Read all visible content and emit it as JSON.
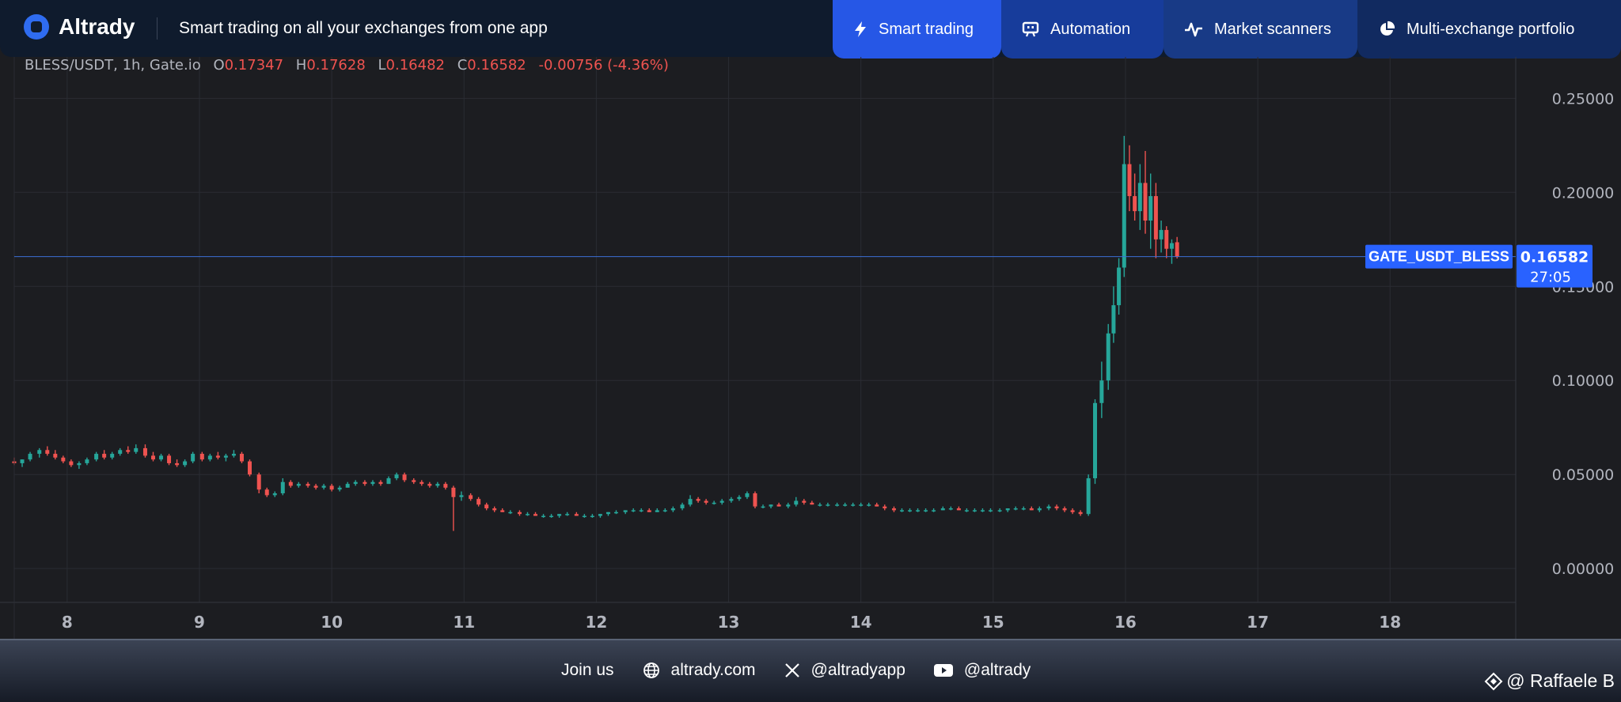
{
  "header": {
    "brand": "Altrady",
    "tagline": "Smart trading on all your exchanges from one app",
    "tabs": [
      {
        "label": "Smart trading",
        "icon": "lightning-icon"
      },
      {
        "label": "Automation",
        "icon": "bot-icon"
      },
      {
        "label": "Market scanners",
        "icon": "pulse-icon"
      },
      {
        "label": "Multi-exchange portfolio",
        "icon": "pie-chart-icon"
      }
    ]
  },
  "legend": {
    "symbol": "BLESS/USDT, 1h, Gate.io",
    "open_label": "O",
    "open": "0.17347",
    "high_label": "H",
    "high": "0.17628",
    "low_label": "L",
    "low": "0.16482",
    "close_label": "C",
    "close": "0.16582",
    "change": "-0.00756 (-4.36%)"
  },
  "price_tag": {
    "name": "GATE_USDT_BLESS",
    "price": "0.16582",
    "countdown": "27:05"
  },
  "footer": {
    "join": "Join us",
    "website": "altrady.com",
    "twitter": "@altradyapp",
    "youtube": "@altrady"
  },
  "watermark": "@ Raffaele B",
  "colors": {
    "up": "#26a69a",
    "down": "#ef5350",
    "accent": "#2962ff",
    "background": "#1c1d21"
  },
  "chart_data": {
    "type": "candlestick",
    "x_ticks": [
      8,
      9,
      10,
      11,
      12,
      13,
      14,
      15,
      16,
      17,
      18
    ],
    "y_ticks": [
      0,
      0.05,
      0.1,
      0.15,
      0.2,
      0.25
    ],
    "y_tick_labels": [
      "0.00000",
      "0.05000",
      "0.10000",
      "0.15000",
      "0.20000",
      "0.25000"
    ],
    "xlim": [
      7.6,
      18.95
    ],
    "ylim": [
      -0.018,
      0.272
    ],
    "last_price": 0.16582,
    "candles": [
      {
        "t": 7.6,
        "o": 0.057,
        "h": 0.059,
        "l": 0.055,
        "c": 0.056
      },
      {
        "t": 7.66,
        "o": 0.056,
        "h": 0.058,
        "l": 0.054,
        "c": 0.058
      },
      {
        "t": 7.72,
        "o": 0.058,
        "h": 0.062,
        "l": 0.057,
        "c": 0.061
      },
      {
        "t": 7.79,
        "o": 0.061,
        "h": 0.064,
        "l": 0.059,
        "c": 0.063
      },
      {
        "t": 7.85,
        "o": 0.063,
        "h": 0.065,
        "l": 0.06,
        "c": 0.061
      },
      {
        "t": 7.91,
        "o": 0.061,
        "h": 0.063,
        "l": 0.058,
        "c": 0.059
      },
      {
        "t": 7.97,
        "o": 0.059,
        "h": 0.06,
        "l": 0.056,
        "c": 0.057
      },
      {
        "t": 8.03,
        "o": 0.057,
        "h": 0.058,
        "l": 0.054,
        "c": 0.055
      },
      {
        "t": 8.09,
        "o": 0.055,
        "h": 0.057,
        "l": 0.053,
        "c": 0.056
      },
      {
        "t": 8.15,
        "o": 0.056,
        "h": 0.059,
        "l": 0.055,
        "c": 0.058
      },
      {
        "t": 8.22,
        "o": 0.058,
        "h": 0.062,
        "l": 0.057,
        "c": 0.061
      },
      {
        "t": 8.28,
        "o": 0.061,
        "h": 0.063,
        "l": 0.058,
        "c": 0.059
      },
      {
        "t": 8.34,
        "o": 0.059,
        "h": 0.062,
        "l": 0.058,
        "c": 0.061
      },
      {
        "t": 8.4,
        "o": 0.061,
        "h": 0.064,
        "l": 0.06,
        "c": 0.063
      },
      {
        "t": 8.46,
        "o": 0.063,
        "h": 0.065,
        "l": 0.061,
        "c": 0.062
      },
      {
        "t": 8.52,
        "o": 0.062,
        "h": 0.066,
        "l": 0.061,
        "c": 0.064
      },
      {
        "t": 8.59,
        "o": 0.064,
        "h": 0.066,
        "l": 0.059,
        "c": 0.06
      },
      {
        "t": 8.65,
        "o": 0.06,
        "h": 0.062,
        "l": 0.057,
        "c": 0.058
      },
      {
        "t": 8.71,
        "o": 0.058,
        "h": 0.061,
        "l": 0.057,
        "c": 0.06
      },
      {
        "t": 8.77,
        "o": 0.06,
        "h": 0.061,
        "l": 0.055,
        "c": 0.056
      },
      {
        "t": 8.83,
        "o": 0.056,
        "h": 0.058,
        "l": 0.054,
        "c": 0.055
      },
      {
        "t": 8.89,
        "o": 0.055,
        "h": 0.058,
        "l": 0.054,
        "c": 0.057
      },
      {
        "t": 8.95,
        "o": 0.057,
        "h": 0.062,
        "l": 0.056,
        "c": 0.061
      },
      {
        "t": 9.02,
        "o": 0.061,
        "h": 0.062,
        "l": 0.057,
        "c": 0.058
      },
      {
        "t": 9.08,
        "o": 0.058,
        "h": 0.061,
        "l": 0.057,
        "c": 0.06
      },
      {
        "t": 9.14,
        "o": 0.06,
        "h": 0.062,
        "l": 0.058,
        "c": 0.059
      },
      {
        "t": 9.2,
        "o": 0.059,
        "h": 0.061,
        "l": 0.057,
        "c": 0.06
      },
      {
        "t": 9.26,
        "o": 0.06,
        "h": 0.063,
        "l": 0.059,
        "c": 0.061
      },
      {
        "t": 9.32,
        "o": 0.061,
        "h": 0.062,
        "l": 0.056,
        "c": 0.057
      },
      {
        "t": 9.38,
        "o": 0.057,
        "h": 0.058,
        "l": 0.049,
        "c": 0.05
      },
      {
        "t": 9.45,
        "o": 0.05,
        "h": 0.051,
        "l": 0.04,
        "c": 0.042
      },
      {
        "t": 9.51,
        "o": 0.042,
        "h": 0.043,
        "l": 0.038,
        "c": 0.039
      },
      {
        "t": 9.57,
        "o": 0.039,
        "h": 0.041,
        "l": 0.038,
        "c": 0.04
      },
      {
        "t": 9.63,
        "o": 0.04,
        "h": 0.048,
        "l": 0.039,
        "c": 0.046
      },
      {
        "t": 9.69,
        "o": 0.046,
        "h": 0.047,
        "l": 0.043,
        "c": 0.044
      },
      {
        "t": 9.75,
        "o": 0.044,
        "h": 0.046,
        "l": 0.043,
        "c": 0.045
      },
      {
        "t": 9.82,
        "o": 0.045,
        "h": 0.046,
        "l": 0.043,
        "c": 0.044
      },
      {
        "t": 9.88,
        "o": 0.044,
        "h": 0.045,
        "l": 0.042,
        "c": 0.043
      },
      {
        "t": 9.94,
        "o": 0.043,
        "h": 0.045,
        "l": 0.042,
        "c": 0.044
      },
      {
        "t": 10.0,
        "o": 0.044,
        "h": 0.045,
        "l": 0.041,
        "c": 0.042
      },
      {
        "t": 10.06,
        "o": 0.042,
        "h": 0.044,
        "l": 0.041,
        "c": 0.043
      },
      {
        "t": 10.12,
        "o": 0.043,
        "h": 0.046,
        "l": 0.043,
        "c": 0.045
      },
      {
        "t": 10.18,
        "o": 0.045,
        "h": 0.047,
        "l": 0.044,
        "c": 0.046
      },
      {
        "t": 10.25,
        "o": 0.046,
        "h": 0.047,
        "l": 0.044,
        "c": 0.045
      },
      {
        "t": 10.31,
        "o": 0.045,
        "h": 0.047,
        "l": 0.044,
        "c": 0.046
      },
      {
        "t": 10.37,
        "o": 0.046,
        "h": 0.047,
        "l": 0.044,
        "c": 0.045
      },
      {
        "t": 10.43,
        "o": 0.045,
        "h": 0.049,
        "l": 0.045,
        "c": 0.048
      },
      {
        "t": 10.49,
        "o": 0.048,
        "h": 0.051,
        "l": 0.047,
        "c": 0.05
      },
      {
        "t": 10.55,
        "o": 0.05,
        "h": 0.051,
        "l": 0.046,
        "c": 0.047
      },
      {
        "t": 10.62,
        "o": 0.047,
        "h": 0.048,
        "l": 0.045,
        "c": 0.046
      },
      {
        "t": 10.68,
        "o": 0.046,
        "h": 0.047,
        "l": 0.044,
        "c": 0.045
      },
      {
        "t": 10.74,
        "o": 0.045,
        "h": 0.046,
        "l": 0.043,
        "c": 0.044
      },
      {
        "t": 10.8,
        "o": 0.044,
        "h": 0.046,
        "l": 0.043,
        "c": 0.045
      },
      {
        "t": 10.86,
        "o": 0.045,
        "h": 0.046,
        "l": 0.042,
        "c": 0.043
      },
      {
        "t": 10.92,
        "o": 0.043,
        "h": 0.044,
        "l": 0.02,
        "c": 0.038
      },
      {
        "t": 10.98,
        "o": 0.038,
        "h": 0.041,
        "l": 0.036,
        "c": 0.039
      },
      {
        "t": 11.05,
        "o": 0.039,
        "h": 0.04,
        "l": 0.036,
        "c": 0.037
      },
      {
        "t": 11.11,
        "o": 0.037,
        "h": 0.038,
        "l": 0.033,
        "c": 0.034
      },
      {
        "t": 11.17,
        "o": 0.034,
        "h": 0.035,
        "l": 0.031,
        "c": 0.032
      },
      {
        "t": 11.23,
        "o": 0.032,
        "h": 0.033,
        "l": 0.03,
        "c": 0.031
      },
      {
        "t": 11.29,
        "o": 0.031,
        "h": 0.032,
        "l": 0.03,
        "c": 0.03
      },
      {
        "t": 11.35,
        "o": 0.03,
        "h": 0.031,
        "l": 0.029,
        "c": 0.03
      },
      {
        "t": 11.42,
        "o": 0.03,
        "h": 0.031,
        "l": 0.028,
        "c": 0.029
      },
      {
        "t": 11.48,
        "o": 0.029,
        "h": 0.03,
        "l": 0.028,
        "c": 0.029
      },
      {
        "t": 11.54,
        "o": 0.029,
        "h": 0.03,
        "l": 0.028,
        "c": 0.028
      },
      {
        "t": 11.6,
        "o": 0.028,
        "h": 0.029,
        "l": 0.027,
        "c": 0.028
      },
      {
        "t": 11.66,
        "o": 0.028,
        "h": 0.029,
        "l": 0.027,
        "c": 0.028
      },
      {
        "t": 11.72,
        "o": 0.028,
        "h": 0.029,
        "l": 0.027,
        "c": 0.029
      },
      {
        "t": 11.78,
        "o": 0.029,
        "h": 0.03,
        "l": 0.028,
        "c": 0.029
      },
      {
        "t": 11.85,
        "o": 0.029,
        "h": 0.03,
        "l": 0.028,
        "c": 0.028
      },
      {
        "t": 11.91,
        "o": 0.028,
        "h": 0.029,
        "l": 0.027,
        "c": 0.028
      },
      {
        "t": 11.97,
        "o": 0.028,
        "h": 0.029,
        "l": 0.027,
        "c": 0.028
      },
      {
        "t": 12.03,
        "o": 0.028,
        "h": 0.029,
        "l": 0.027,
        "c": 0.029
      },
      {
        "t": 12.09,
        "o": 0.029,
        "h": 0.03,
        "l": 0.028,
        "c": 0.03
      },
      {
        "t": 12.15,
        "o": 0.03,
        "h": 0.031,
        "l": 0.029,
        "c": 0.03
      },
      {
        "t": 12.22,
        "o": 0.03,
        "h": 0.031,
        "l": 0.029,
        "c": 0.031
      },
      {
        "t": 12.28,
        "o": 0.031,
        "h": 0.032,
        "l": 0.03,
        "c": 0.031
      },
      {
        "t": 12.34,
        "o": 0.031,
        "h": 0.032,
        "l": 0.03,
        "c": 0.031
      },
      {
        "t": 12.4,
        "o": 0.031,
        "h": 0.032,
        "l": 0.03,
        "c": 0.03
      },
      {
        "t": 12.46,
        "o": 0.03,
        "h": 0.032,
        "l": 0.03,
        "c": 0.031
      },
      {
        "t": 12.52,
        "o": 0.031,
        "h": 0.032,
        "l": 0.03,
        "c": 0.031
      },
      {
        "t": 12.58,
        "o": 0.031,
        "h": 0.033,
        "l": 0.03,
        "c": 0.032
      },
      {
        "t": 12.65,
        "o": 0.032,
        "h": 0.035,
        "l": 0.031,
        "c": 0.034
      },
      {
        "t": 12.71,
        "o": 0.034,
        "h": 0.039,
        "l": 0.033,
        "c": 0.037
      },
      {
        "t": 12.77,
        "o": 0.037,
        "h": 0.038,
        "l": 0.035,
        "c": 0.036
      },
      {
        "t": 12.83,
        "o": 0.036,
        "h": 0.037,
        "l": 0.034,
        "c": 0.035
      },
      {
        "t": 12.89,
        "o": 0.035,
        "h": 0.036,
        "l": 0.034,
        "c": 0.035
      },
      {
        "t": 12.95,
        "o": 0.035,
        "h": 0.037,
        "l": 0.034,
        "c": 0.036
      },
      {
        "t": 13.02,
        "o": 0.036,
        "h": 0.038,
        "l": 0.035,
        "c": 0.037
      },
      {
        "t": 13.08,
        "o": 0.037,
        "h": 0.039,
        "l": 0.036,
        "c": 0.038
      },
      {
        "t": 13.14,
        "o": 0.038,
        "h": 0.041,
        "l": 0.037,
        "c": 0.04
      },
      {
        "t": 13.2,
        "o": 0.04,
        "h": 0.041,
        "l": 0.032,
        "c": 0.033
      },
      {
        "t": 13.26,
        "o": 0.033,
        "h": 0.034,
        "l": 0.032,
        "c": 0.033
      },
      {
        "t": 13.32,
        "o": 0.033,
        "h": 0.034,
        "l": 0.032,
        "c": 0.034
      },
      {
        "t": 13.38,
        "o": 0.034,
        "h": 0.035,
        "l": 0.033,
        "c": 0.033
      },
      {
        "t": 13.45,
        "o": 0.033,
        "h": 0.035,
        "l": 0.032,
        "c": 0.034
      },
      {
        "t": 13.51,
        "o": 0.034,
        "h": 0.038,
        "l": 0.033,
        "c": 0.036
      },
      {
        "t": 13.57,
        "o": 0.036,
        "h": 0.037,
        "l": 0.034,
        "c": 0.035
      },
      {
        "t": 13.63,
        "o": 0.035,
        "h": 0.036,
        "l": 0.034,
        "c": 0.034
      },
      {
        "t": 13.69,
        "o": 0.034,
        "h": 0.035,
        "l": 0.033,
        "c": 0.034
      },
      {
        "t": 13.75,
        "o": 0.034,
        "h": 0.035,
        "l": 0.033,
        "c": 0.034
      },
      {
        "t": 13.82,
        "o": 0.034,
        "h": 0.035,
        "l": 0.033,
        "c": 0.034
      },
      {
        "t": 13.88,
        "o": 0.034,
        "h": 0.035,
        "l": 0.033,
        "c": 0.034
      },
      {
        "t": 13.94,
        "o": 0.034,
        "h": 0.035,
        "l": 0.033,
        "c": 0.034
      },
      {
        "t": 14.0,
        "o": 0.034,
        "h": 0.035,
        "l": 0.033,
        "c": 0.034
      },
      {
        "t": 14.06,
        "o": 0.034,
        "h": 0.035,
        "l": 0.033,
        "c": 0.034
      },
      {
        "t": 14.12,
        "o": 0.034,
        "h": 0.035,
        "l": 0.033,
        "c": 0.033
      },
      {
        "t": 14.18,
        "o": 0.033,
        "h": 0.034,
        "l": 0.031,
        "c": 0.032
      },
      {
        "t": 14.25,
        "o": 0.032,
        "h": 0.033,
        "l": 0.03,
        "c": 0.031
      },
      {
        "t": 14.31,
        "o": 0.031,
        "h": 0.032,
        "l": 0.03,
        "c": 0.031
      },
      {
        "t": 14.37,
        "o": 0.031,
        "h": 0.032,
        "l": 0.03,
        "c": 0.031
      },
      {
        "t": 14.43,
        "o": 0.031,
        "h": 0.032,
        "l": 0.03,
        "c": 0.031
      },
      {
        "t": 14.49,
        "o": 0.031,
        "h": 0.032,
        "l": 0.03,
        "c": 0.031
      },
      {
        "t": 14.55,
        "o": 0.031,
        "h": 0.032,
        "l": 0.03,
        "c": 0.031
      },
      {
        "t": 14.62,
        "o": 0.031,
        "h": 0.033,
        "l": 0.031,
        "c": 0.032
      },
      {
        "t": 14.68,
        "o": 0.032,
        "h": 0.033,
        "l": 0.031,
        "c": 0.032
      },
      {
        "t": 14.74,
        "o": 0.032,
        "h": 0.033,
        "l": 0.031,
        "c": 0.031
      },
      {
        "t": 14.8,
        "o": 0.031,
        "h": 0.032,
        "l": 0.03,
        "c": 0.031
      },
      {
        "t": 14.86,
        "o": 0.031,
        "h": 0.032,
        "l": 0.03,
        "c": 0.031
      },
      {
        "t": 14.92,
        "o": 0.031,
        "h": 0.032,
        "l": 0.03,
        "c": 0.031
      },
      {
        "t": 14.98,
        "o": 0.031,
        "h": 0.032,
        "l": 0.03,
        "c": 0.031
      },
      {
        "t": 15.05,
        "o": 0.031,
        "h": 0.032,
        "l": 0.03,
        "c": 0.031
      },
      {
        "t": 15.11,
        "o": 0.031,
        "h": 0.032,
        "l": 0.03,
        "c": 0.032
      },
      {
        "t": 15.17,
        "o": 0.032,
        "h": 0.033,
        "l": 0.031,
        "c": 0.032
      },
      {
        "t": 15.23,
        "o": 0.032,
        "h": 0.033,
        "l": 0.031,
        "c": 0.032
      },
      {
        "t": 15.29,
        "o": 0.032,
        "h": 0.033,
        "l": 0.031,
        "c": 0.031
      },
      {
        "t": 15.35,
        "o": 0.031,
        "h": 0.033,
        "l": 0.03,
        "c": 0.032
      },
      {
        "t": 15.42,
        "o": 0.032,
        "h": 0.034,
        "l": 0.031,
        "c": 0.033
      },
      {
        "t": 15.48,
        "o": 0.033,
        "h": 0.034,
        "l": 0.031,
        "c": 0.032
      },
      {
        "t": 15.54,
        "o": 0.032,
        "h": 0.033,
        "l": 0.03,
        "c": 0.031
      },
      {
        "t": 15.6,
        "o": 0.031,
        "h": 0.032,
        "l": 0.029,
        "c": 0.03
      },
      {
        "t": 15.66,
        "o": 0.03,
        "h": 0.031,
        "l": 0.028,
        "c": 0.029
      },
      {
        "t": 15.72,
        "o": 0.029,
        "h": 0.05,
        "l": 0.028,
        "c": 0.048
      },
      {
        "t": 15.77,
        "o": 0.048,
        "h": 0.09,
        "l": 0.045,
        "c": 0.088
      },
      {
        "t": 15.82,
        "o": 0.088,
        "h": 0.11,
        "l": 0.08,
        "c": 0.1
      },
      {
        "t": 15.87,
        "o": 0.1,
        "h": 0.13,
        "l": 0.095,
        "c": 0.125
      },
      {
        "t": 15.91,
        "o": 0.125,
        "h": 0.15,
        "l": 0.12,
        "c": 0.14
      },
      {
        "t": 15.95,
        "o": 0.14,
        "h": 0.165,
        "l": 0.135,
        "c": 0.16
      },
      {
        "t": 15.99,
        "o": 0.16,
        "h": 0.23,
        "l": 0.155,
        "c": 0.215
      },
      {
        "t": 16.03,
        "o": 0.215,
        "h": 0.225,
        "l": 0.19,
        "c": 0.198
      },
      {
        "t": 16.07,
        "o": 0.198,
        "h": 0.21,
        "l": 0.185,
        "c": 0.19
      },
      {
        "t": 16.11,
        "o": 0.19,
        "h": 0.215,
        "l": 0.18,
        "c": 0.205
      },
      {
        "t": 16.15,
        "o": 0.205,
        "h": 0.222,
        "l": 0.178,
        "c": 0.185
      },
      {
        "t": 16.19,
        "o": 0.185,
        "h": 0.21,
        "l": 0.17,
        "c": 0.198
      },
      {
        "t": 16.23,
        "o": 0.198,
        "h": 0.205,
        "l": 0.165,
        "c": 0.175
      },
      {
        "t": 16.27,
        "o": 0.175,
        "h": 0.185,
        "l": 0.168,
        "c": 0.18
      },
      {
        "t": 16.31,
        "o": 0.18,
        "h": 0.182,
        "l": 0.165,
        "c": 0.17
      },
      {
        "t": 16.35,
        "o": 0.17,
        "h": 0.175,
        "l": 0.162,
        "c": 0.173
      },
      {
        "t": 16.39,
        "o": 0.17347,
        "h": 0.17628,
        "l": 0.16482,
        "c": 0.16582
      }
    ]
  }
}
